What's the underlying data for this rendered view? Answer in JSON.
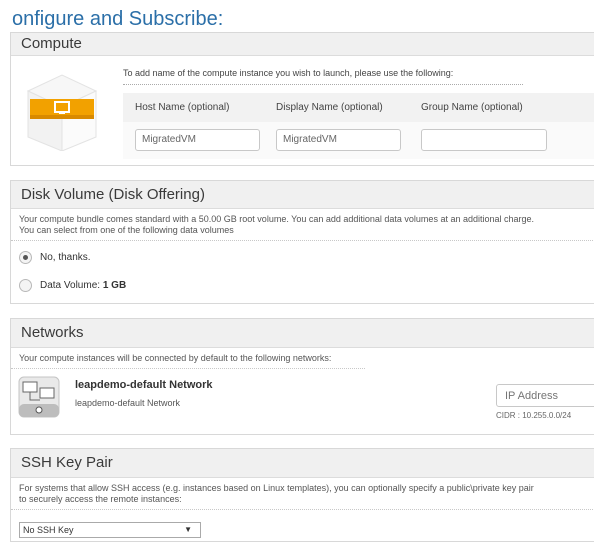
{
  "page": {
    "title": "onfigure and Subscribe:"
  },
  "compute": {
    "header": "Compute",
    "instruction": "To add name of the compute instance you wish to launch, please use the following:",
    "columns": [
      "Host Name (optional)",
      "Display Name (optional)",
      "Group Name (optional)"
    ],
    "values": {
      "host": "MigratedVM",
      "display": "MigratedVM",
      "group": ""
    }
  },
  "disk": {
    "header": "Disk Volume (Disk Offering)",
    "desc_line1": "Your compute bundle comes standard with a 50.00 GB root volume. You can add additional data volumes at an additional charge.",
    "desc_line2": "You can select from one of the following data volumes",
    "option_no": "No, thanks.",
    "option_data_prefix": "Data Volume:",
    "option_data_size": "1 GB",
    "selected": "No, thanks."
  },
  "networks": {
    "header": "Networks",
    "desc": "Your compute instances will be connected by default to the following networks:",
    "network_name": "leapdemo-default Network",
    "network_sub": "leapdemo-default Network",
    "ip_placeholder": "IP Address",
    "cidr": "CIDR : 10.255.0.0/24"
  },
  "ssh": {
    "header": "SSH Key Pair",
    "desc_line1": "For systems that allow SSH access (e.g. instances based on Linux templates), you can optionally specify a public\\private key pair",
    "desc_line2": "to securely access the remote instances:",
    "selected_key": "No SSH Key",
    "arrow_icon": "triangle-down-icon"
  },
  "colors": {
    "title": "#2b6fa8",
    "cube_orange": "#f2a100"
  }
}
